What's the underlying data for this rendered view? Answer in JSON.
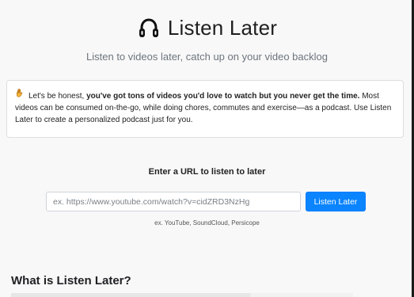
{
  "header": {
    "title": "Listen Later",
    "subtitle": "Listen to videos later, catch up on your video backlog",
    "icon": "headphones-icon"
  },
  "notice": {
    "prefix": "Let's be honest, ",
    "bold": "you've got tons of videos you'd love to watch but you never get the time.",
    "body": " Most videos can be consumed on-the-go, while doing chores, commutes and exercise—as a podcast. Use Listen Later to create a personalized podcast just for you.",
    "icon": "raised-hand-icon"
  },
  "form": {
    "label": "Enter a URL to listen to later",
    "placeholder": "ex. https://www.youtube.com/watch?v=cidZRD3NzHg",
    "button_label": "Listen Later",
    "examples": "ex. YouTube, SoundCloud, Persicope"
  },
  "section": {
    "title": "What is Listen Later?"
  },
  "colors": {
    "background": "#f8f8f8",
    "button": "#0a84ff",
    "text": "#212529",
    "muted": "#6c757d"
  }
}
